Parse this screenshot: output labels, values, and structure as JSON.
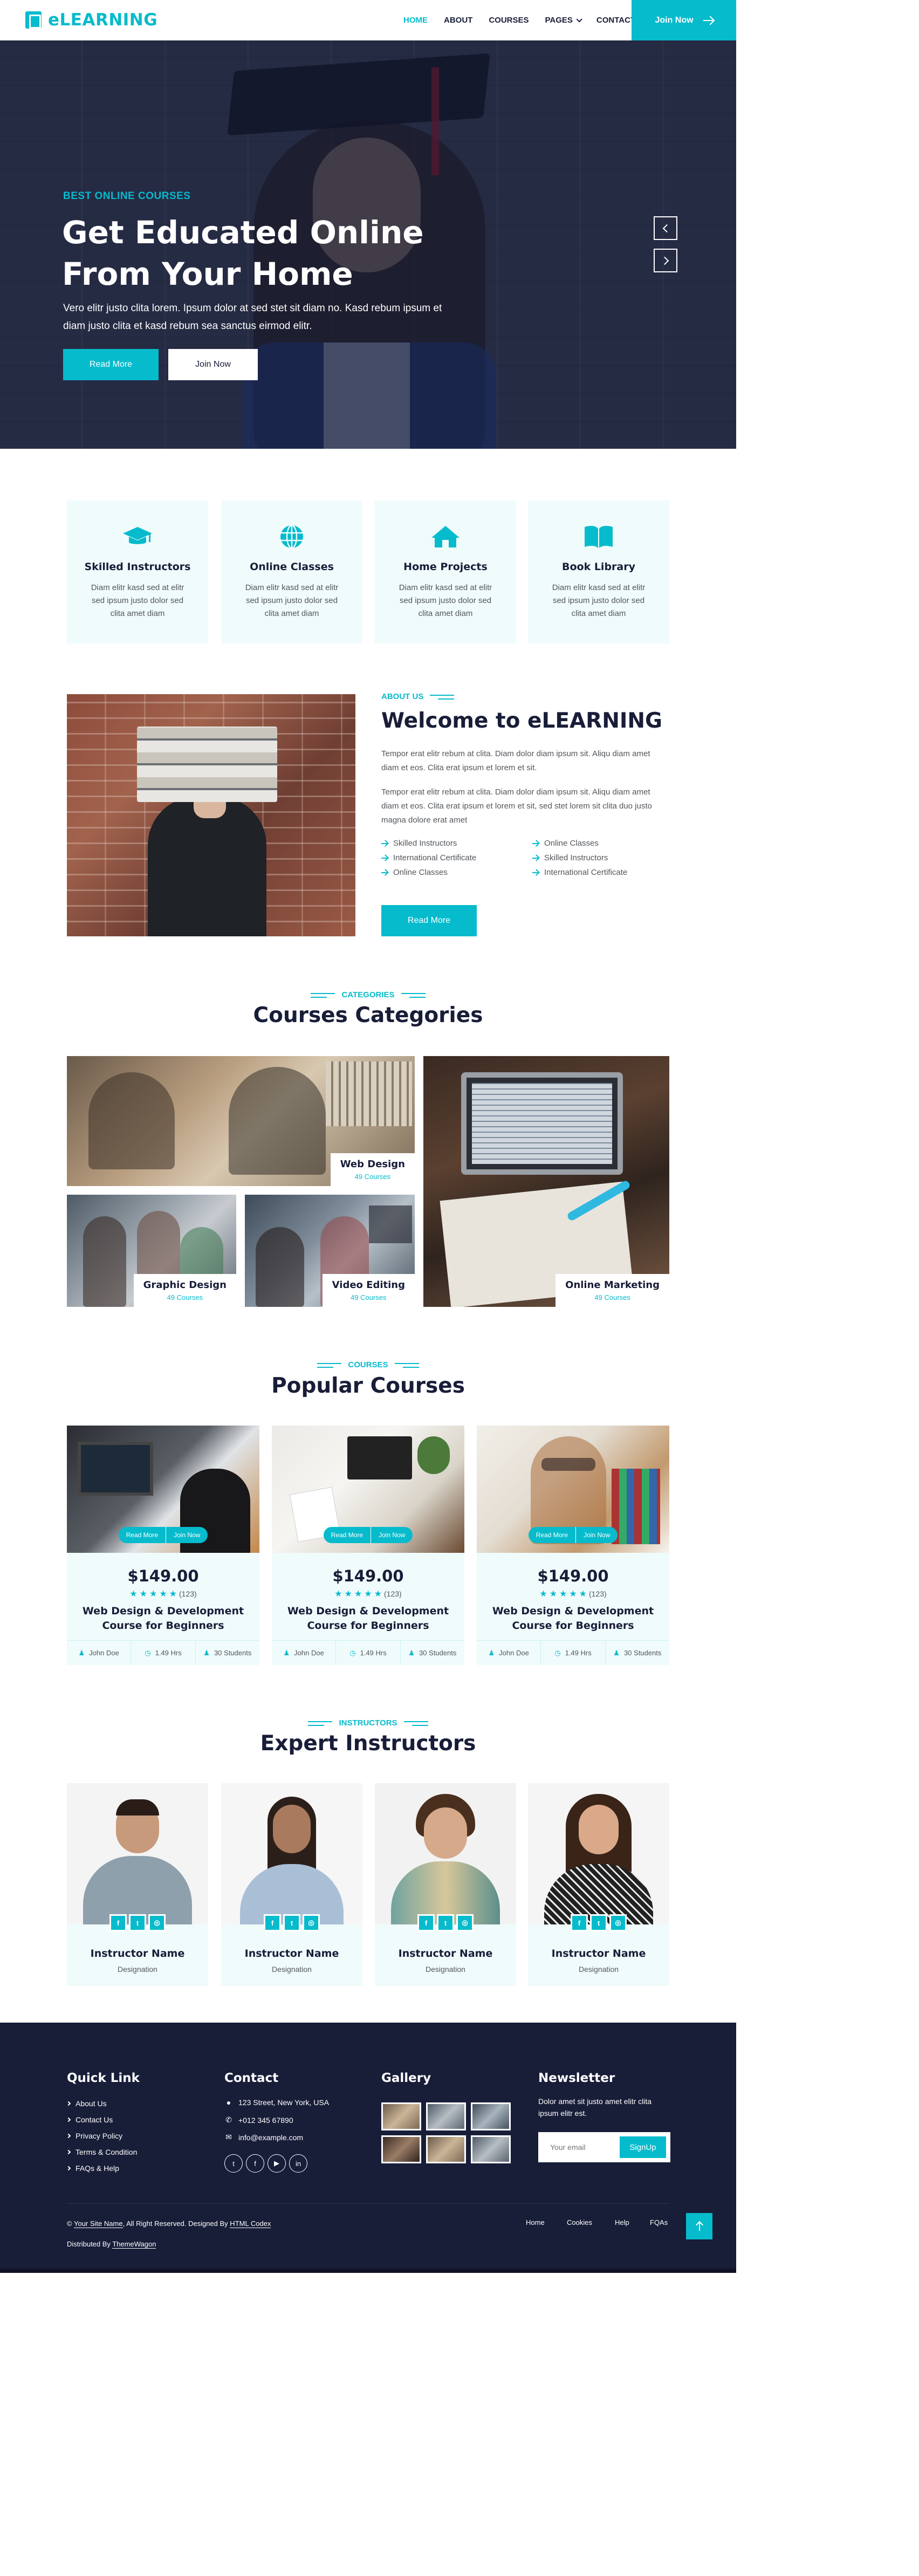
{
  "brand": {
    "name": "eLEARNING"
  },
  "nav": {
    "items": [
      {
        "label": "HOME"
      },
      {
        "label": "ABOUT"
      },
      {
        "label": "COURSES"
      },
      {
        "label": "PAGES"
      },
      {
        "label": "CONTACT"
      }
    ],
    "join_label": "Join Now"
  },
  "hero": {
    "subtitle": "Best Online Courses",
    "title": "Get Educated Online From Your Home",
    "text": "Vero elitr justo clita lorem. Ipsum dolor at sed stet sit diam no. Kasd rebum ipsum et diam justo clita et kasd rebum sea sanctus eirmod elitr.",
    "read_more": "Read More",
    "join_now": "Join Now"
  },
  "services": [
    {
      "title": "Skilled Instructors",
      "text": "Diam elitr kasd sed at elitr sed ipsum justo dolor sed clita amet diam",
      "icon": "graduation-cap-icon"
    },
    {
      "title": "Online Classes",
      "text": "Diam elitr kasd sed at elitr sed ipsum justo dolor sed clita amet diam",
      "icon": "globe-icon"
    },
    {
      "title": "Home Projects",
      "text": "Diam elitr kasd sed at elitr sed ipsum justo dolor sed clita amet diam",
      "icon": "home-icon"
    },
    {
      "title": "Book Library",
      "text": "Diam elitr kasd sed at elitr sed ipsum justo dolor sed clita amet diam",
      "icon": "book-open-icon"
    }
  ],
  "about": {
    "label": "About Us",
    "title": "Welcome to eLEARNING",
    "p1": "Tempor erat elitr rebum at clita. Diam dolor diam ipsum sit. Aliqu diam amet diam et eos. Clita erat ipsum et lorem et sit.",
    "p2": "Tempor erat elitr rebum at clita. Diam dolor diam ipsum sit. Aliqu diam amet diam et eos. Clita erat ipsum et lorem et sit, sed stet lorem sit clita duo justo magna dolore erat amet",
    "checks": [
      "Skilled Instructors",
      "Online Classes",
      "International Certificate",
      "Skilled Instructors",
      "Online Classes",
      "International Certificate"
    ],
    "read_more": "Read More"
  },
  "categories": {
    "label": "Categories",
    "title": "Courses Categories",
    "items": [
      {
        "name": "Web Design",
        "count": "49 Courses"
      },
      {
        "name": "Graphic Design",
        "count": "49 Courses"
      },
      {
        "name": "Video Editing",
        "count": "49 Courses"
      },
      {
        "name": "Online Marketing",
        "count": "49 Courses"
      }
    ]
  },
  "courses": {
    "label": "Courses",
    "title": "Popular Courses",
    "read_more": "Read More",
    "join_now": "Join Now",
    "items": [
      {
        "price": "$149.00",
        "reviews": "(123)",
        "title": "Web Design & Development Course for Beginners",
        "author": "John Doe",
        "hours": "1.49 Hrs",
        "students": "30 Students",
        "rating": 5
      },
      {
        "price": "$149.00",
        "reviews": "(123)",
        "title": "Web Design & Development Course for Beginners",
        "author": "John Doe",
        "hours": "1.49 Hrs",
        "students": "30 Students",
        "rating": 5
      },
      {
        "price": "$149.00",
        "reviews": "(123)",
        "title": "Web Design & Development Course for Beginners",
        "author": "John Doe",
        "hours": "1.49 Hrs",
        "students": "30 Students",
        "rating": 5
      }
    ]
  },
  "team": {
    "label": "Instructors",
    "title": "Expert Instructors",
    "items": [
      {
        "name": "Instructor Name",
        "role": "Designation"
      },
      {
        "name": "Instructor Name",
        "role": "Designation"
      },
      {
        "name": "Instructor Name",
        "role": "Designation"
      },
      {
        "name": "Instructor Name",
        "role": "Designation"
      }
    ]
  },
  "footer": {
    "quick_link": {
      "title": "Quick Link",
      "items": [
        "About Us",
        "Contact Us",
        "Privacy Policy",
        "Terms & Condition",
        "FAQs & Help"
      ]
    },
    "contact": {
      "title": "Contact",
      "address": "123 Street, New York, USA",
      "phone": "+012 345 67890",
      "email": "info@example.com"
    },
    "gallery": {
      "title": "Gallery"
    },
    "newsletter": {
      "title": "Newsletter",
      "text": "Dolor amet sit justo amet elitr clita ipsum elitr est.",
      "placeholder": "Your email",
      "button": "SignUp"
    },
    "copyright": {
      "prefix": "©",
      "site": "Your Site Name",
      "middle": ", All Right Reserved. Designed By",
      "designer": "HTML Codex",
      "distributed": "Distributed By",
      "distributor": "ThemeWagon"
    },
    "menu": [
      "Home",
      "Cookies",
      "Help",
      "FQAs"
    ]
  },
  "colors": {
    "primary": "#06bbcc",
    "dark": "#181d38",
    "light": "#f0fbfc"
  }
}
